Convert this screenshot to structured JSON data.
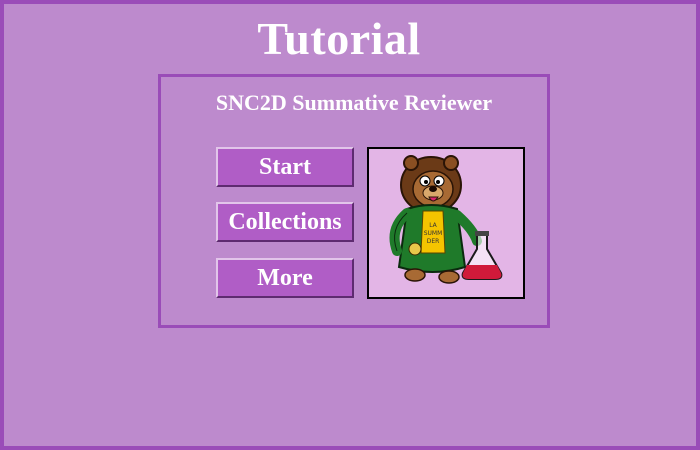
{
  "window": {
    "title": "Tutorial",
    "colors": {
      "background": "#bd8acd",
      "border": "#9a4cb8",
      "button": "#b05dc6"
    }
  },
  "panel": {
    "title": "SNC2D Summative Reviewer",
    "buttons": {
      "start": "Start",
      "collections": "Collections",
      "more": "More"
    }
  },
  "mascot": {
    "icon": "lion-scientist-icon",
    "coat_text": "LA\nSUMM\nDER"
  }
}
